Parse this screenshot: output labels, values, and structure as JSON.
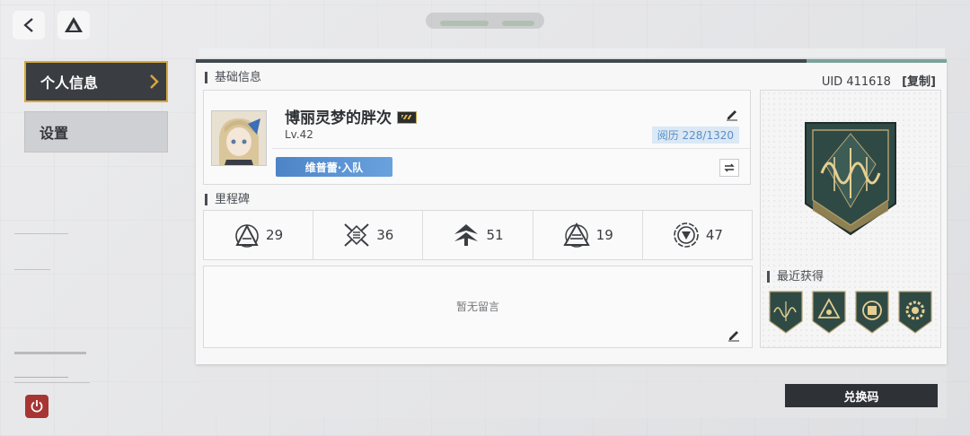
{
  "nav": {
    "items": [
      {
        "label": "个人信息",
        "active": true
      },
      {
        "label": "设置",
        "active": false
      }
    ]
  },
  "profile": {
    "section_title": "基础信息",
    "uid_label": "UID",
    "uid_value": "411618",
    "copy_label": "[复制]",
    "player_name": "博丽灵梦的胖次",
    "level": "Lv.42",
    "experience": "阅历 228/1320",
    "team_tag": "维普蕾·入队"
  },
  "milestones": {
    "title": "里程碑",
    "items": [
      {
        "icon": "triangle-a-icon",
        "value": "29"
      },
      {
        "icon": "cross-list-icon",
        "value": "36"
      },
      {
        "icon": "arrow-chevron-icon",
        "value": "51"
      },
      {
        "icon": "pyramid-icon",
        "value": "19"
      },
      {
        "icon": "circle-target-icon",
        "value": "47"
      }
    ]
  },
  "message": {
    "empty_text": "暂无留言"
  },
  "recent": {
    "title": "最近获得",
    "items": [
      {
        "icon": "wave-badge-icon"
      },
      {
        "icon": "triangle-badge-icon"
      },
      {
        "icon": "circle-badge-icon"
      },
      {
        "icon": "gear-badge-icon"
      }
    ]
  },
  "actions": {
    "redeem_label": "兑换码"
  },
  "colors": {
    "accent_gold": "#d8a83a",
    "badge_teal": "#2f4a45",
    "power_red": "#a73534",
    "exp_blue": "#5a8fc7"
  }
}
